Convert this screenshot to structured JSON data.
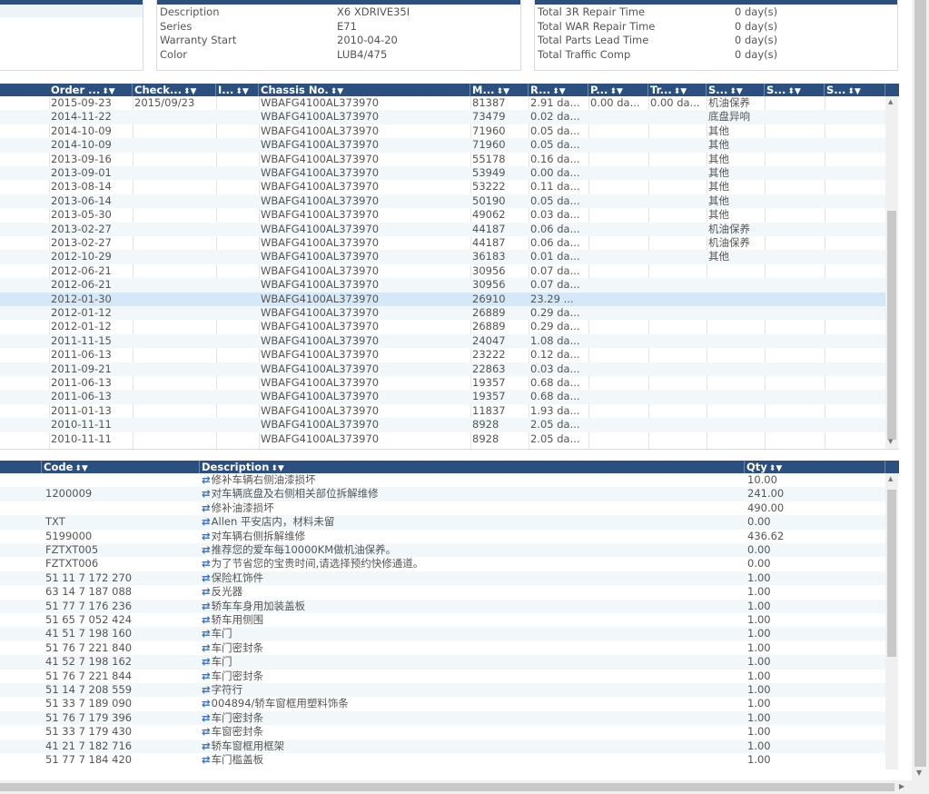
{
  "vehicle_info": {
    "rows": [
      {
        "label": "Description",
        "value": "X6 XDRIVE35I"
      },
      {
        "label": "Series",
        "value": "E71"
      },
      {
        "label": "Warranty Start",
        "value": "2010-04-20"
      },
      {
        "label": "Color",
        "value": "LUB4/475"
      }
    ]
  },
  "totals": {
    "rows": [
      {
        "label": "Total 3R Repair Time",
        "value": "0 day(s)"
      },
      {
        "label": "Total WAR Repair Time",
        "value": "0 day(s)"
      },
      {
        "label": "Total Parts Lead Time",
        "value": "0 day(s)"
      },
      {
        "label": "Total Traffic Comp",
        "value": "0 day(s)"
      }
    ]
  },
  "orders_grid": {
    "header_icons": "⬍▼",
    "columns": [
      "Order ...",
      "Check...",
      "I...",
      "Chassis No.",
      "M...",
      "R...",
      "P...",
      "Tr...",
      "S...",
      "S...",
      "S..."
    ],
    "rows": [
      [
        "2015-09-23",
        "2015/09/23",
        "",
        "WBAFG4100AL373970",
        "81387",
        "2.91 da...",
        "0.00 da...",
        "0.00 da...",
        "机油保养",
        "",
        ""
      ],
      [
        "2014-11-22",
        "",
        "",
        "WBAFG4100AL373970",
        "73479",
        "0.02 da...",
        "",
        "",
        "底盘异响",
        "",
        ""
      ],
      [
        "2014-10-09",
        "",
        "",
        "WBAFG4100AL373970",
        "71960",
        "0.05 da...",
        "",
        "",
        "其他",
        "",
        ""
      ],
      [
        "2014-10-09",
        "",
        "",
        "WBAFG4100AL373970",
        "71960",
        "0.05 da...",
        "",
        "",
        "其他",
        "",
        ""
      ],
      [
        "2013-09-16",
        "",
        "",
        "WBAFG4100AL373970",
        "55178",
        "0.16 da...",
        "",
        "",
        "其他",
        "",
        ""
      ],
      [
        "2013-09-01",
        "",
        "",
        "WBAFG4100AL373970",
        "53949",
        "0.00 da...",
        "",
        "",
        "其他",
        "",
        ""
      ],
      [
        "2013-08-14",
        "",
        "",
        "WBAFG4100AL373970",
        "53222",
        "0.11 da...",
        "",
        "",
        "其他",
        "",
        ""
      ],
      [
        "2013-06-14",
        "",
        "",
        "WBAFG4100AL373970",
        "50190",
        "0.05 da...",
        "",
        "",
        "其他",
        "",
        ""
      ],
      [
        "2013-05-30",
        "",
        "",
        "WBAFG4100AL373970",
        "49062",
        "0.03 da...",
        "",
        "",
        "其他",
        "",
        ""
      ],
      [
        "2013-02-27",
        "",
        "",
        "WBAFG4100AL373970",
        "44187",
        "0.06 da...",
        "",
        "",
        "机油保养",
        "",
        ""
      ],
      [
        "2013-02-27",
        "",
        "",
        "WBAFG4100AL373970",
        "44187",
        "0.06 da...",
        "",
        "",
        "机油保养",
        "",
        ""
      ],
      [
        "2012-10-29",
        "",
        "",
        "WBAFG4100AL373970",
        "36183",
        "0.01 da...",
        "",
        "",
        "其他",
        "",
        ""
      ],
      [
        "2012-06-21",
        "",
        "",
        "WBAFG4100AL373970",
        "30956",
        "0.07 da...",
        "",
        "",
        "",
        "",
        ""
      ],
      [
        "2012-06-21",
        "",
        "",
        "WBAFG4100AL373970",
        "30956",
        "0.07 da...",
        "",
        "",
        "",
        "",
        ""
      ],
      [
        "2012-01-30",
        "",
        "",
        "WBAFG4100AL373970",
        "26910",
        "23.29 ...",
        "",
        "",
        "",
        "",
        ""
      ],
      [
        "2012-01-12",
        "",
        "",
        "WBAFG4100AL373970",
        "26889",
        "0.29 da...",
        "",
        "",
        "",
        "",
        ""
      ],
      [
        "2012-01-12",
        "",
        "",
        "WBAFG4100AL373970",
        "26889",
        "0.29 da...",
        "",
        "",
        "",
        "",
        ""
      ],
      [
        "2011-11-15",
        "",
        "",
        "WBAFG4100AL373970",
        "24047",
        "1.08 da...",
        "",
        "",
        "",
        "",
        ""
      ],
      [
        "2011-06-13",
        "",
        "",
        "WBAFG4100AL373970",
        "23222",
        "0.12 da...",
        "",
        "",
        "",
        "",
        ""
      ],
      [
        "2011-09-21",
        "",
        "",
        "WBAFG4100AL373970",
        "22863",
        "0.03 da...",
        "",
        "",
        "",
        "",
        ""
      ],
      [
        "2011-06-13",
        "",
        "",
        "WBAFG4100AL373970",
        "19357",
        "0.68 da...",
        "",
        "",
        "",
        "",
        ""
      ],
      [
        "2011-06-13",
        "",
        "",
        "WBAFG4100AL373970",
        "19357",
        "0.68 da...",
        "",
        "",
        "",
        "",
        ""
      ],
      [
        "2011-01-13",
        "",
        "",
        "WBAFG4100AL373970",
        "11837",
        "1.93 da...",
        "",
        "",
        "",
        "",
        ""
      ],
      [
        "2010-11-11",
        "",
        "",
        "WBAFG4100AL373970",
        "8928",
        "2.05 da...",
        "",
        "",
        "",
        "",
        ""
      ],
      [
        "2010-11-11",
        "",
        "",
        "WBAFG4100AL373970",
        "8928",
        "2.05 da...",
        "",
        "",
        "",
        "",
        ""
      ]
    ],
    "selected_row": 14
  },
  "parts_grid": {
    "header_icons": "⬍▼",
    "swap_icon": "⇄",
    "columns": [
      "Code",
      "Description",
      "Qty"
    ],
    "rows": [
      [
        "",
        "修补车辆右侧油漆损坏",
        "10.00"
      ],
      [
        "1200009",
        "对车辆底盘及右侧相关部位拆解维修",
        "241.00"
      ],
      [
        "",
        "修补油漆损坏",
        "490.00"
      ],
      [
        "TXT",
        "Allen 平安店内，材料未留",
        "0.00"
      ],
      [
        "5199000",
        "对车辆右侧拆解维修",
        "436.62"
      ],
      [
        "FZTXT005",
        "推荐您的爱车每10000KM做机油保养。",
        "0.00"
      ],
      [
        "FZTXT006",
        "为了节省您的宝贵时间,请选择预约快修通道。",
        "0.00"
      ],
      [
        "51 11 7 172 270",
        "保险杠饰件",
        "1.00"
      ],
      [
        "63 14 7 187 088",
        "反光器",
        "1.00"
      ],
      [
        "51 77 7 176 236",
        "轿车车身用加装盖板",
        "1.00"
      ],
      [
        "51 65 7 052 424",
        "轿车用侧围",
        "1.00"
      ],
      [
        "41 51 7 198 160",
        "车门",
        "1.00"
      ],
      [
        "51 76 7 221 840",
        "车门密封条",
        "1.00"
      ],
      [
        "41 52 7 198 162",
        "车门",
        "1.00"
      ],
      [
        "51 76 7 221 844",
        "车门密封条",
        "1.00"
      ],
      [
        "51 14 7 208 559",
        "字符行",
        "1.00"
      ],
      [
        "51 33 7 189 090",
        "004894/轿车窗框用塑料饰条",
        "1.00"
      ],
      [
        "51 76 7 179 396",
        "车门密封条",
        "1.00"
      ],
      [
        "51 33 7 179 430",
        "车窗密封条",
        "1.00"
      ],
      [
        "41 21 7 182 716",
        "轿车窗框用框架",
        "1.00"
      ],
      [
        "51 77 7 184 420",
        "车门槛盖板",
        "1.00"
      ]
    ]
  },
  "colors": {
    "header_bg": "#2b4f7e",
    "alt_row": "#f2f7fa",
    "selected_row": "#d5e8f7",
    "swap_icon": "#3a6fc4"
  }
}
